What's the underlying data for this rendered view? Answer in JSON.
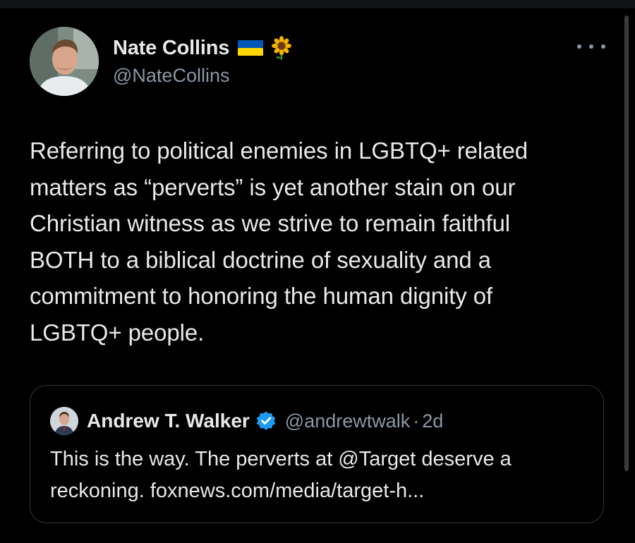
{
  "tweet": {
    "author_name": "Nate Collins",
    "author_handle": "@NateCollins",
    "author_emoji_flag": "ukraine-flag",
    "author_emoji_flower": "sunflower",
    "body_lines": [
      "Referring to political enemies in LGBTQ+ related",
      "matters as “perverts” is yet another stain on our",
      "Christian witness as we strive to remain faithful",
      "BOTH to a biblical doctrine of sexuality and a",
      "commitment to honoring the human dignity of",
      "LGBTQ+ people."
    ],
    "more_icon": "more-options-icon"
  },
  "quoted": {
    "author_name": "Andrew T. Walker",
    "author_handle": "@andrewtwalk",
    "separator": "·",
    "time": "2d",
    "verified_icon": "verified-badge-icon",
    "text_lines": [
      "This is the way. The perverts at @Target deserve a",
      "reckoning. foxnews.com/media/target-h..."
    ]
  },
  "colors": {
    "background": "#000000",
    "text_primary": "#e7e9ea",
    "text_secondary": "#8b98a5",
    "border": "#2f3336",
    "verified_blue": "#1d9bf0",
    "flag_blue": "#0057b7",
    "flag_yellow": "#ffd700"
  }
}
